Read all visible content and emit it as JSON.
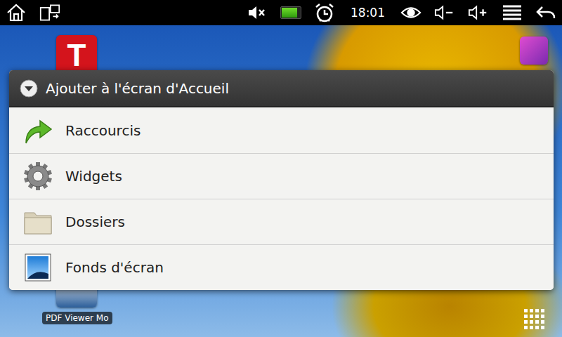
{
  "status_bar": {
    "time": "18:01",
    "sound_muted": true,
    "battery": {
      "level": 0.85
    }
  },
  "desktop": {
    "top_app": {
      "logo": "T"
    },
    "bottom_app": {
      "label": "PDF Viewer Mo"
    }
  },
  "dialog": {
    "title": "Ajouter à l'écran d'Accueil",
    "items": [
      {
        "label": "Raccourcis",
        "kind": "shortcut"
      },
      {
        "label": "Widgets",
        "kind": "widget"
      },
      {
        "label": "Dossiers",
        "kind": "folder"
      },
      {
        "label": "Fonds d'écran",
        "kind": "wallpaper"
      }
    ]
  }
}
